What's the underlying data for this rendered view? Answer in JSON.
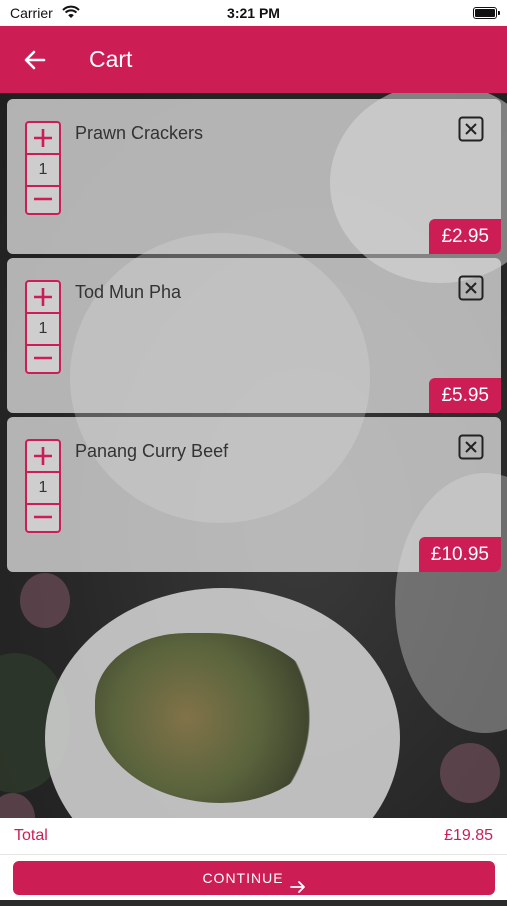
{
  "status_bar": {
    "carrier": "Carrier",
    "time": "3:21 PM"
  },
  "header": {
    "title": "Cart",
    "back_icon": "arrow-left-icon"
  },
  "colors": {
    "accent": "#cc1e55",
    "card_bg": "#dcdcdc"
  },
  "cart": {
    "items": [
      {
        "name": "Prawn Crackers",
        "quantity": "1",
        "price": "£2.95"
      },
      {
        "name": "Tod Mun Pha",
        "quantity": "1",
        "price": "£5.95"
      },
      {
        "name": "Panang Curry Beef",
        "quantity": "1",
        "price": "£10.95"
      }
    ]
  },
  "footer": {
    "total_label": "Total",
    "total_value": "£19.85",
    "continue_label": "CONTINUE"
  }
}
